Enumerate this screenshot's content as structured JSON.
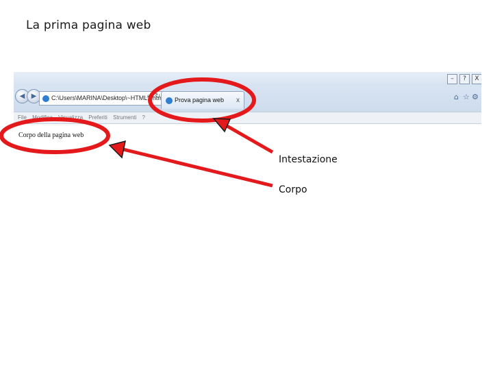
{
  "slide": {
    "title": "La prima pagina web"
  },
  "browser": {
    "address_text": "C:\\Users\\MARINA\\Desktop\\~HTML1.html",
    "tab_title": "Prova pagina web",
    "tab_close": "x",
    "menu": [
      "File",
      "Modifica",
      "Visualizza",
      "Preferiti",
      "Strumenti",
      "?"
    ],
    "window_buttons": [
      "–",
      "?",
      "X"
    ],
    "page_body_text": "Corpo della pagina web"
  },
  "annotations": {
    "heading_label": "Intestazione",
    "body_label": "Corpo",
    "highlight_color": "#e3191c"
  }
}
